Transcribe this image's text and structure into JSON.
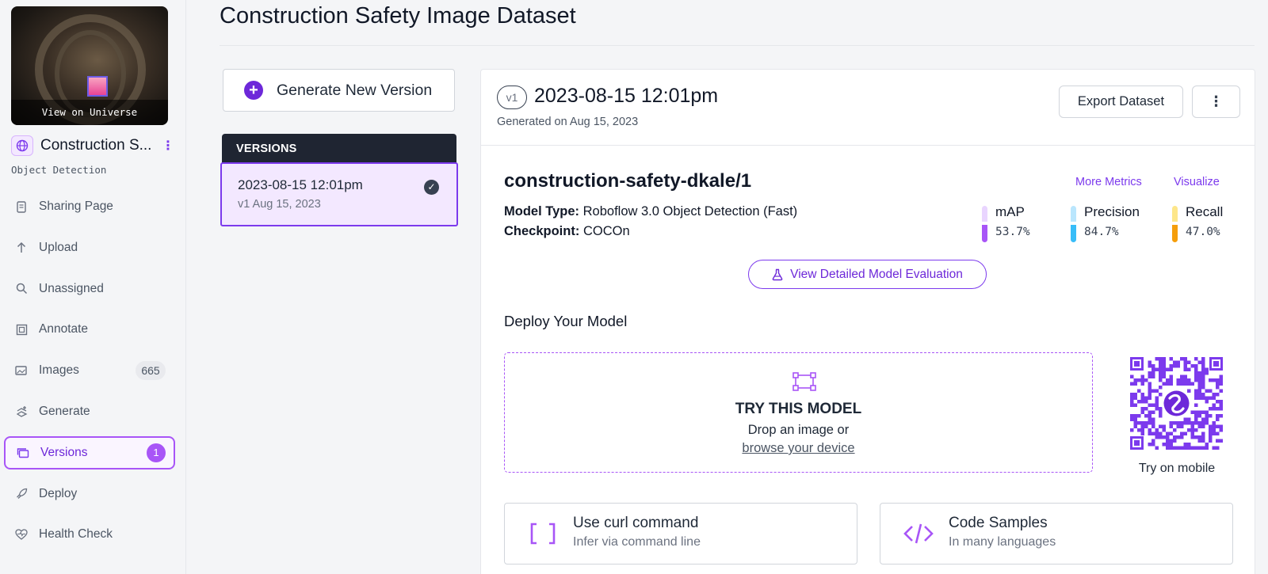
{
  "sidebar": {
    "thumbnail_label": "View on Universe",
    "project_name": "Construction S...",
    "project_type": "Object Detection",
    "items": [
      {
        "label": "Sharing Page",
        "icon": "document-icon"
      },
      {
        "label": "Upload",
        "icon": "arrow-up-icon"
      },
      {
        "label": "Unassigned",
        "icon": "search-icon"
      },
      {
        "label": "Annotate",
        "icon": "annotate-icon"
      },
      {
        "label": "Images",
        "icon": "images-icon",
        "badge": "665"
      },
      {
        "label": "Generate",
        "icon": "generate-icon"
      },
      {
        "label": "Versions",
        "icon": "versions-icon",
        "badge": "1",
        "active": true
      },
      {
        "label": "Deploy",
        "icon": "rocket-icon"
      },
      {
        "label": "Health Check",
        "icon": "heart-pulse-icon"
      }
    ]
  },
  "page": {
    "title": "Construction Safety Image Dataset"
  },
  "versions_panel": {
    "generate_label": "Generate New Version",
    "header": "VERSIONS",
    "selected": {
      "title": "2023-08-15 12:01pm",
      "subtitle": "v1 Aug 15, 2023"
    }
  },
  "version_detail": {
    "pill": "v1",
    "title": "2023-08-15 12:01pm",
    "generated": "Generated on Aug 15, 2023",
    "export_label": "Export Dataset",
    "more_label": "⋮",
    "model": {
      "name": "construction-safety-dkale/1",
      "more_metrics": "More Metrics",
      "visualize": "Visualize",
      "type_label": "Model Type:",
      "type_value": "Roboflow 3.0 Object Detection (Fast)",
      "checkpoint_label": "Checkpoint:",
      "checkpoint_value": "COCOn",
      "metrics": [
        {
          "label": "mAP",
          "value": "53.7%",
          "value_num": 53.7,
          "color_light": "#e9d5ff",
          "color": "#a855f7"
        },
        {
          "label": "Precision",
          "value": "84.7%",
          "value_num": 84.7,
          "color_light": "#bae6fd",
          "color": "#38bdf8"
        },
        {
          "label": "Recall",
          "value": "47.0%",
          "value_num": 47.0,
          "color_light": "#fde68a",
          "color": "#f59e0b"
        }
      ],
      "eval_label": "View Detailed Model Evaluation"
    },
    "deploy": {
      "title": "Deploy Your Model",
      "try_title": "TRY THIS MODEL",
      "try_line1": "Drop an image or",
      "try_link": "browse your device",
      "mobile_label": "Try on mobile",
      "cards": [
        {
          "title": "Use curl command",
          "subtitle": "Infer via command line",
          "icon": "brackets-icon"
        },
        {
          "title": "Code Samples",
          "subtitle": "In many languages",
          "icon": "code-icon"
        }
      ]
    }
  },
  "colors": {
    "accent": "#7c3aed",
    "accent_light": "#f3e8ff",
    "dark_header": "#1f2532"
  }
}
